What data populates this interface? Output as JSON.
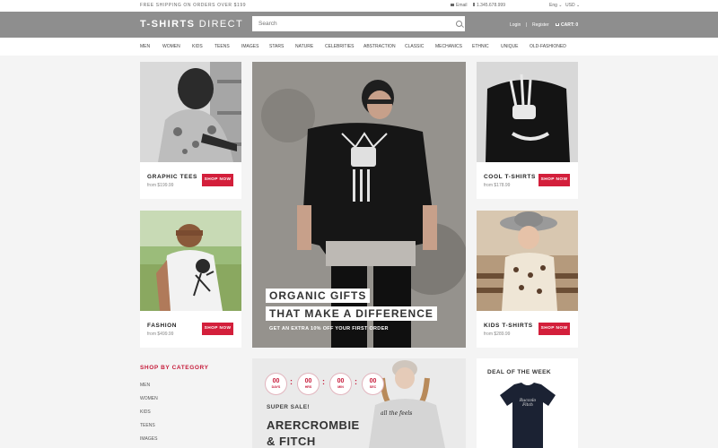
{
  "topbar": {
    "shipping": "FREE SHIPPING ON ORDERS OVER $199",
    "email": "Email",
    "phone": "1.345.678.999",
    "lang": "Eng",
    "currency": "USD"
  },
  "header": {
    "logo_bold": "T-SHIRTS",
    "logo_thin": "DIRECT",
    "search_placeholder": "Search",
    "login": "Login",
    "separator": "|",
    "register": "Register",
    "cart": "CART: 0"
  },
  "nav": [
    "MEN",
    "WOMEN",
    "KIDS",
    "TEENS",
    "IMAGES",
    "STARS",
    "NATURE",
    "CELEBRITIES",
    "ABSTRACTION",
    "CLASSIC",
    "MECHANICS",
    "ETHNIC",
    "UNIQUE",
    "OLD-FASHIONED"
  ],
  "products": [
    {
      "title": "GRAPHIC TEES",
      "price": "from $199.99",
      "button": "SHOP NOW"
    },
    {
      "title": "FASHION",
      "price": "from $499.99",
      "button": "SHOP NOW"
    },
    {
      "title": "COOL T-SHIRTS",
      "price": "from $178.99",
      "button": "SHOP NOW"
    },
    {
      "title": "KIDS T-SHIRTS",
      "price": "from $289.99",
      "button": "SHOP NOW"
    }
  ],
  "hero": {
    "line1": "ORGANIC GIFTS",
    "line2": "THAT MAKE A DIFFERENCE",
    "sub": "GET AN EXTRA 10% OFF YOUR FIRST ORDER"
  },
  "sidebar": {
    "title": "SHOP BY CATEGORY",
    "categories": [
      "MEN",
      "WOMEN",
      "KIDS",
      "TEENS",
      "IMAGES"
    ]
  },
  "sale": {
    "countdown": [
      {
        "value": "00",
        "unit": "DAYS"
      },
      {
        "value": "00",
        "unit": "HRS"
      },
      {
        "value": "00",
        "unit": "MIN"
      },
      {
        "value": "00",
        "unit": "SEC"
      }
    ],
    "label": "SUPER SALE!",
    "brand_line1": "ARERCROMBIE",
    "brand_line2": "& FITCH",
    "shirt_text": "all the feels"
  },
  "deal": {
    "title": "DEAL OF THE WEEK",
    "shirt_text": "Ruccolo Fitch"
  },
  "colors": {
    "accent": "#d31f3b",
    "header_bg": "#8e8e8e"
  }
}
